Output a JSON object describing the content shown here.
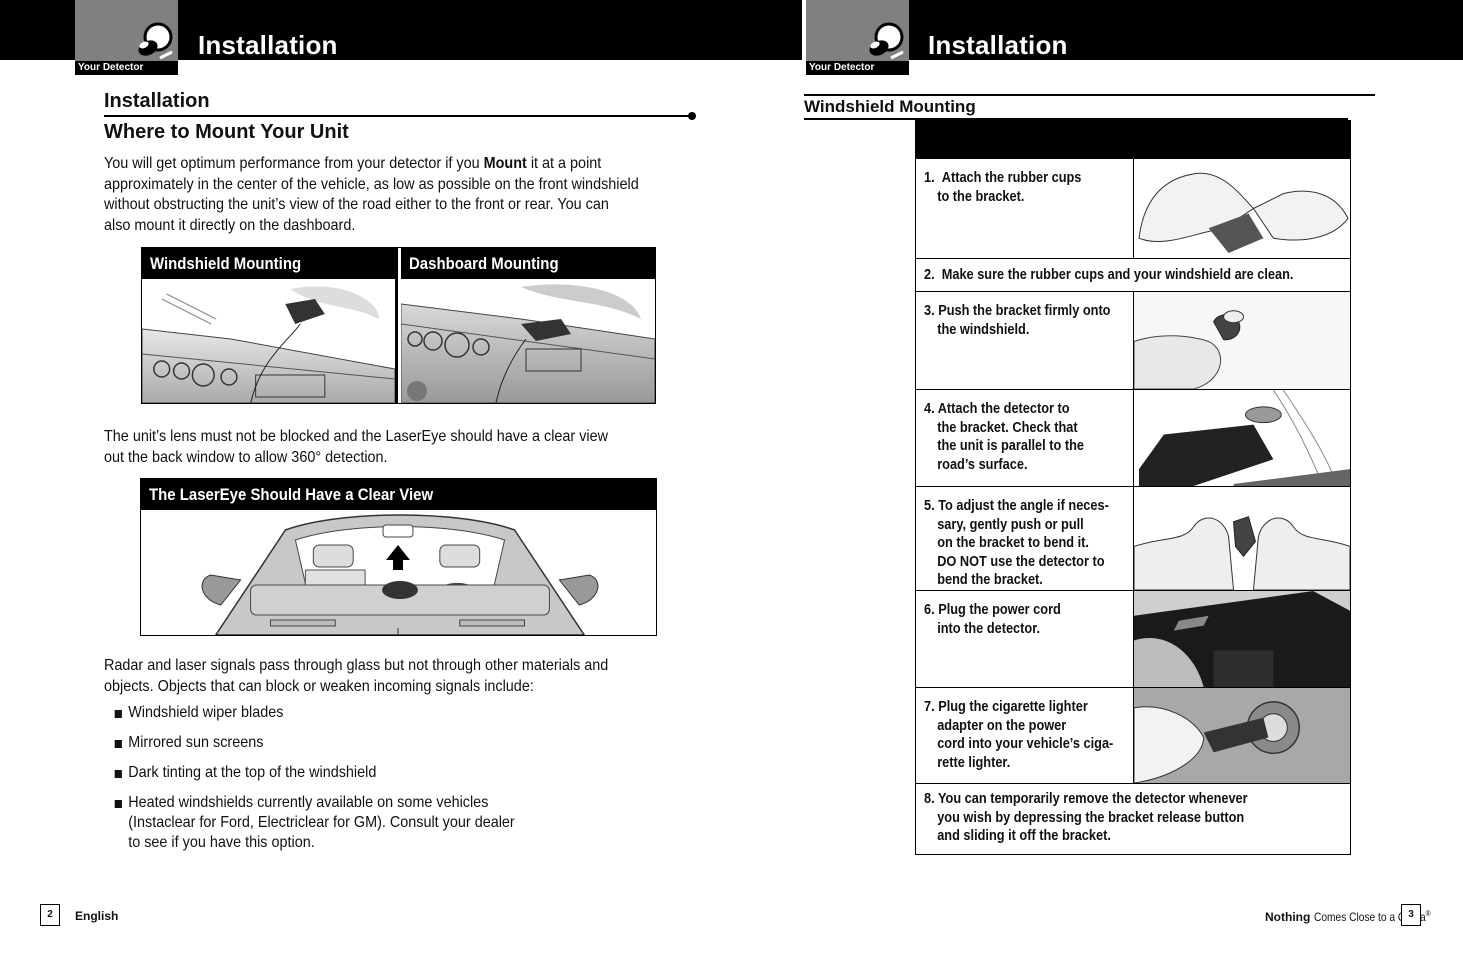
{
  "left_page": {
    "header": {
      "logo_label": "Your Detector",
      "logo_icon": "detector-mascot-icon",
      "title": "Installation"
    },
    "section_title": "Installation",
    "subsection_title": "Where to Mount Your Unit",
    "intro": {
      "line1_pre": "You will get optimum performance from your detector if you ",
      "line1_bold": "Mount",
      "line1_post": " it at a point",
      "line2": "approximately in the center of the vehicle, as low as possible on the front windshield",
      "line3": "without obstructing the unit’s view of the road either to the front or rear. You can",
      "line4": "also mount it directly on the dashboard."
    },
    "mount_figure": {
      "col1_title": "Windshield Mounting",
      "col2_title": "Dashboard Mounting"
    },
    "lens_paragraph": {
      "line1": "The unit’s lens must not be blocked and the LaserEye should have a clear view",
      "line2": "out the back window to allow 360° detection."
    },
    "laser_figure": {
      "title": "The LaserEye Should Have a Clear View"
    },
    "signals_paragraph": {
      "line1": "Radar and laser signals pass through glass but not through other materials and",
      "line2": "objects. Objects that can block or weaken incoming signals include:"
    },
    "bullets": [
      {
        "lines": [
          "Windshield wiper blades"
        ]
      },
      {
        "lines": [
          "Mirrored sun screens"
        ]
      },
      {
        "lines": [
          "Dark tinting at the top of the windshield"
        ]
      },
      {
        "lines": [
          "Heated windshields currently available on some vehicles",
          "(Instaclear for Ford, Electriclear for GM). Consult your dealer",
          "to see if you have this option."
        ]
      }
    ],
    "footer": {
      "page_number": "2",
      "language": "English"
    }
  },
  "right_page": {
    "header": {
      "logo_label": "Your Detector",
      "logo_icon": "detector-mascot-icon",
      "title": "Installation"
    },
    "section_title": "Windshield Mounting",
    "steps": [
      {
        "num": "1.",
        "lines": [
          "Attach the rubber cups",
          "to the bracket."
        ],
        "image": "hands-attaching-cups"
      },
      {
        "num": "2.",
        "lines": [
          "Make sure the rubber cups and your windshield are clean."
        ]
      },
      {
        "num": "3.",
        "lines": [
          "Push the bracket firmly onto",
          "the windshield."
        ],
        "image": "finger-pushing-bracket"
      },
      {
        "num": "4.",
        "lines": [
          "Attach the detector to",
          "the bracket."
        ],
        "bold_lines": [
          "Check that",
          "the unit is parallel to the",
          "road’s surface."
        ],
        "image": "detector-on-bracket"
      },
      {
        "num": "5.",
        "lines": [
          "To adjust the angle if neces-",
          "sary, gently push or pull",
          "on the bracket to bend it.",
          "DO NOT use the detector to",
          "bend the bracket."
        ],
        "image": "hands-bending-bracket"
      },
      {
        "num": "6.",
        "lines": [
          "Plug the power cord",
          "into the detector."
        ],
        "image": "plugging-power-cord"
      },
      {
        "num": "7.",
        "lines": [
          "Plug the cigarette lighter",
          "adapter on the power",
          "cord into your vehicle’s ciga-",
          "rette lighter."
        ],
        "image": "plugging-lighter-adapter"
      },
      {
        "num": "8.",
        "lines": [
          "You can temporarily remove the detector whenever",
          "you wish by depressing the bracket release button",
          "and sliding it off the bracket."
        ]
      }
    ],
    "footer": {
      "tagline_bold": "Nothing",
      "tagline_rest": "Comes Close to a Cobra",
      "trademark": "®",
      "page_number": "3"
    }
  }
}
